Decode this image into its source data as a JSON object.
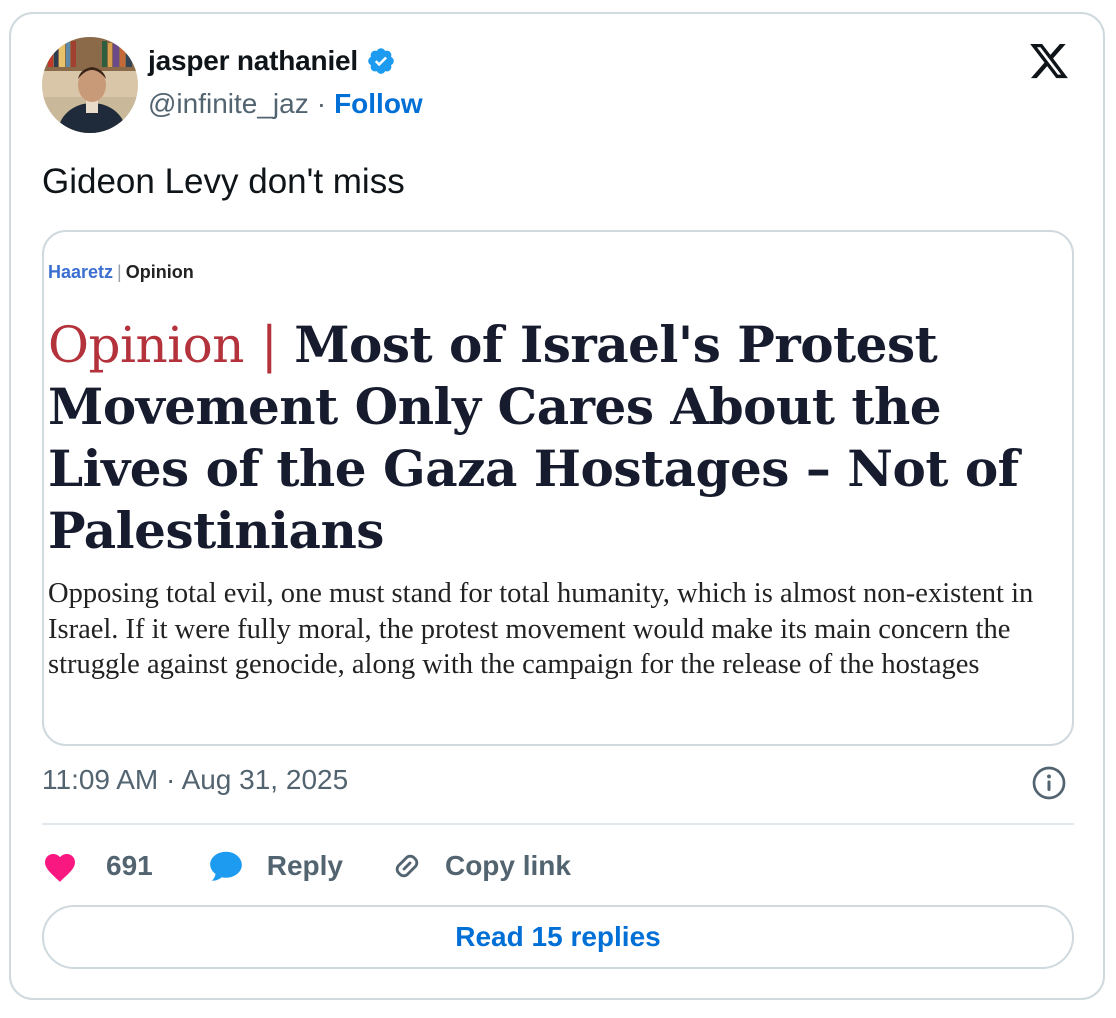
{
  "author": {
    "display_name": "jasper nathaniel",
    "handle": "@infinite_jaz",
    "separator": "·",
    "follow_label": "Follow"
  },
  "tweet": {
    "text": "Gideon Levy don't miss"
  },
  "embed": {
    "source_brand": "Haaretz",
    "source_separator": "|",
    "source_section": "Opinion",
    "headline_kicker": "Opinion",
    "headline_separator": "|",
    "headline": "Most of Israel's Protest Movement Only Cares About the Lives of the Gaza Hostages – Not of Palestinians",
    "dek": "Opposing total evil, one must stand for total humanity, which is almost non-existent in Israel. If it were fully moral, the protest movement would make its main concern the struggle against genocide, along with the campaign for the release of the hostages"
  },
  "meta": {
    "timestamp": "11:09 AM · Aug 31, 2025"
  },
  "actions": {
    "likes_count": "691",
    "reply_label": "Reply",
    "copy_link_label": "Copy link",
    "read_replies_label": "Read 15 replies"
  },
  "icons": {
    "verified": "verified-badge-icon",
    "x_logo": "x-logo-icon",
    "info": "info-icon",
    "heart": "heart-icon",
    "reply": "speech-bubble-icon",
    "link": "link-icon"
  },
  "colors": {
    "heart": "#f91880",
    "reply_bubble": "#1d9bf0",
    "link_blue": "#006fd6",
    "kicker_red": "#b3323b",
    "haaretz_blue": "#3b6fd0"
  }
}
